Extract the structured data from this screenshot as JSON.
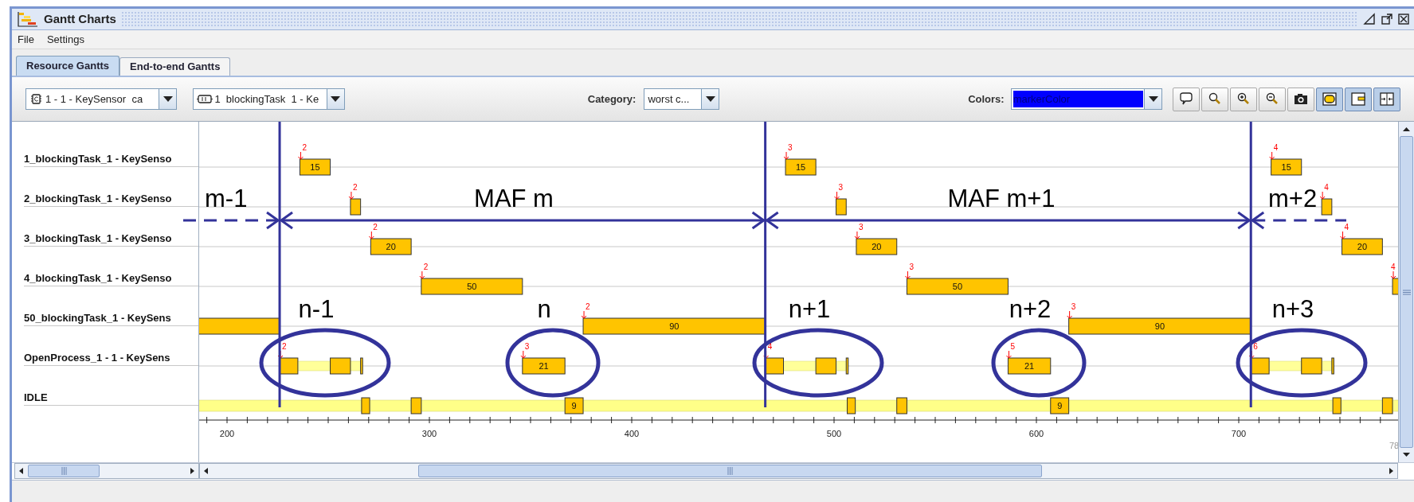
{
  "window": {
    "title": "Gantt Charts"
  },
  "menu": [
    {
      "label": "File"
    },
    {
      "label": "Settings"
    }
  ],
  "tabs": [
    {
      "label": "Resource Gantts",
      "selected": true
    },
    {
      "label": "End-to-end Gantts",
      "selected": false
    }
  ],
  "toolbar": {
    "resource": {
      "value": "1 - 1 - KeySensor  ca"
    },
    "task": {
      "value": "1  blockingTask  1 - Ke"
    },
    "category": {
      "label": "Category:",
      "value": "worst c..."
    },
    "colors": {
      "label": "Colors:",
      "value": "markerColor"
    },
    "buttons": [
      {
        "kind": "comment",
        "selected": false
      },
      {
        "kind": "search",
        "selected": false
      },
      {
        "kind": "zoom-in",
        "selected": false
      },
      {
        "kind": "zoom-out",
        "selected": false
      },
      {
        "kind": "camera",
        "selected": false
      },
      {
        "kind": "rounded",
        "selected": true
      },
      {
        "kind": "panel",
        "selected": true
      },
      {
        "kind": "fit",
        "selected": true
      }
    ]
  },
  "gantt": {
    "axis_ticks": [
      "200",
      "300",
      "400",
      "500",
      "600",
      "700"
    ],
    "rows": [
      {
        "label": "1_blockingTask_1 - KeySenso",
        "bars": [
          {
            "kind": "busy",
            "label": "15",
            "marker": "2"
          },
          {
            "kind": "busy",
            "label": "15",
            "marker": "3"
          },
          {
            "kind": "busy",
            "label": "15",
            "marker": "4"
          }
        ]
      },
      {
        "label": "2_blockingTask_1 - KeySenso",
        "bars": [
          {
            "kind": "busy",
            "marker": "2"
          },
          {
            "kind": "busy",
            "marker": "3"
          },
          {
            "kind": "busy",
            "marker": "4"
          }
        ]
      },
      {
        "label": "3_blockingTask_1 - KeySenso",
        "bars": [
          {
            "kind": "busy",
            "label": "20",
            "marker": "2"
          },
          {
            "kind": "busy",
            "label": "20",
            "marker": "3"
          },
          {
            "kind": "busy",
            "label": "20",
            "marker": "4"
          }
        ]
      },
      {
        "label": "4_blockingTask_1 - KeySenso",
        "bars": [
          {
            "kind": "busy",
            "label": "50",
            "marker": "2"
          },
          {
            "kind": "busy",
            "label": "50",
            "marker": "3"
          },
          {
            "kind": "busy",
            "marker": "4"
          }
        ]
      },
      {
        "label": "50_blockingTask_1 - KeySens",
        "bars": [
          {
            "kind": "busy"
          },
          {
            "kind": "busy",
            "label": "90",
            "marker": "2"
          },
          {
            "kind": "busy",
            "label": "90",
            "marker": "3"
          }
        ]
      },
      {
        "label": "OpenProcess_1 - 1 - KeySens",
        "bars": [
          {
            "kind": "waiting"
          },
          {
            "kind": "busy",
            "marker": "2"
          },
          {
            "kind": "busy"
          },
          {
            "kind": "busy"
          },
          {
            "kind": "busy",
            "label": "21",
            "marker": "3"
          },
          {
            "kind": "waiting"
          },
          {
            "kind": "busy",
            "marker": "4"
          },
          {
            "kind": "busy"
          },
          {
            "kind": "busy"
          },
          {
            "kind": "busy",
            "label": "21",
            "marker": "5"
          },
          {
            "kind": "waiting"
          },
          {
            "kind": "busy",
            "marker": "6"
          },
          {
            "kind": "busy"
          },
          {
            "kind": "busy"
          }
        ]
      },
      {
        "label": "IDLE",
        "bars": [
          {
            "kind": "idle"
          },
          {
            "kind": "busy"
          },
          {
            "kind": "busy"
          },
          {
            "kind": "busy",
            "label": "9"
          },
          {
            "kind": "busy"
          },
          {
            "kind": "busy"
          },
          {
            "kind": "busy",
            "label": "9"
          },
          {
            "kind": "busy"
          },
          {
            "kind": "busy"
          }
        ]
      }
    ],
    "axis_end_label": "78",
    "annotations": {
      "maf_labels": [
        "m-1",
        "MAF m",
        "MAF m+1",
        "m+2"
      ],
      "frame_labels": [
        "n-1",
        "n",
        "n+1",
        "n+2",
        "n+3"
      ]
    }
  }
}
